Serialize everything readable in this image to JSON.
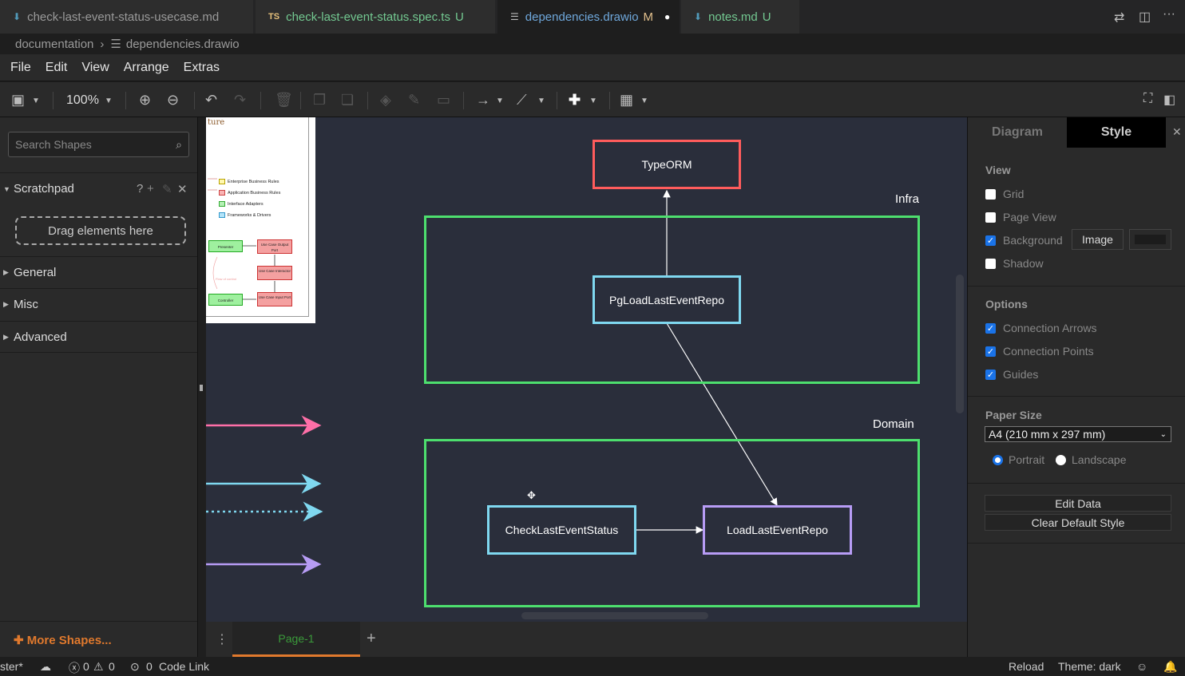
{
  "tabs": [
    {
      "label": "check-last-event-status-usecase.md",
      "status": "",
      "icon": "markdown-icon"
    },
    {
      "label": "check-last-event-status.spec.ts",
      "status": "U",
      "icon": "typescript-icon",
      "icon_text": "TS"
    },
    {
      "label": "dependencies.drawio",
      "status": "M",
      "icon": "drawio-file-icon"
    },
    {
      "label": "notes.md",
      "status": "U",
      "icon": "markdown-icon"
    }
  ],
  "breadcrumb": {
    "folder": "documentation",
    "file": "dependencies.drawio"
  },
  "menu": [
    "File",
    "Edit",
    "View",
    "Arrange",
    "Extras"
  ],
  "toolbar": {
    "zoom": "100%"
  },
  "left": {
    "search_placeholder": "Search Shapes",
    "scratchpad": "Scratchpad",
    "scratchpad_help": "?",
    "drag_hint": "Drag elements here",
    "sections": [
      "General",
      "Misc",
      "Advanced"
    ],
    "more_shapes": "More Shapes..."
  },
  "diagram": {
    "typeorm": "TypeORM",
    "infra_label": "Infra",
    "pg_repo": "PgLoadLastEventRepo",
    "domain_label": "Domain",
    "check_status": "CheckLastEventStatus",
    "load_repo": "LoadLastEventRepo",
    "thumb_title": "ture",
    "legend": [
      "Enterprise Business Rules",
      "Application Business Rules",
      "Interface Adapters",
      "Frameworks & Drivers"
    ],
    "thumb_boxes": [
      "Presenter",
      "Use Case Output Port",
      "Use Case Interactor",
      "Controller",
      "Use Case Input Port"
    ],
    "thumb_flow_label": "Flow of control",
    "arrow_colors": [
      "#ff6fa8",
      "#7fd8f0",
      "#7fd8f0",
      "#b79cf5"
    ]
  },
  "page_tab": "Page-1",
  "right": {
    "tab_diagram": "Diagram",
    "tab_style": "Style",
    "view_title": "View",
    "grid": "Grid",
    "page_view": "Page View",
    "background": "Background",
    "image_btn": "Image",
    "shadow": "Shadow",
    "options_title": "Options",
    "conn_arrows": "Connection Arrows",
    "conn_points": "Connection Points",
    "guides": "Guides",
    "paper_title": "Paper Size",
    "paper_value": "A4 (210 mm x 297 mm)",
    "portrait": "Portrait",
    "landscape": "Landscape",
    "edit_data": "Edit Data",
    "clear_style": "Clear Default Style"
  },
  "status": {
    "branch": "ster*",
    "errors": "0",
    "warnings": "0",
    "ports": "0",
    "code_link": "Code Link",
    "reload": "Reload",
    "theme": "Theme: dark"
  },
  "colors": {
    "accent": "#1a73e8",
    "red": "#ff5c5c",
    "green": "#4ddf6e",
    "cyan": "#7fd8f0",
    "purple": "#b79cf5",
    "orange": "#e0792d"
  }
}
